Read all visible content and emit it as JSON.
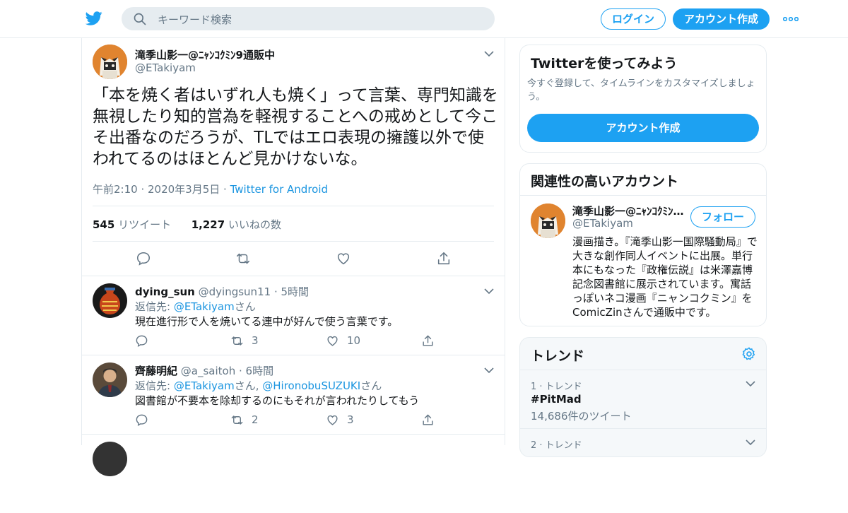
{
  "header": {
    "search_placeholder": "キーワード検索",
    "login_label": "ログイン",
    "signup_label": "アカウント作成"
  },
  "tweet": {
    "author_name": "滝季山影一@ﾆｬﾝｺｸﾐﾝ9通販中",
    "author_handle": "@ETakiyam",
    "text": "「本を焼く者はいずれ人も焼く」って言葉、専門知識を無視したり知的営為を軽視することへの戒めとして今こそ出番なのだろうが、TLではエロ表現の擁護以外で使われてるのはほとんど見かけないな。",
    "timestamp": "午前2:10 · 2020年3月5日",
    "separator": "·",
    "source": "Twitter for Android",
    "retweet_count": "545",
    "retweet_label": "リツイート",
    "like_count": "1,227",
    "like_label": "いいねの数"
  },
  "replies": [
    {
      "name": "dying_sun",
      "handle": "@dyingsun11",
      "time": "· 5時間",
      "reply_prefix": "返信先: ",
      "reply_to": "@ETakiyam",
      "reply_suffix": "さん",
      "reply_to2": "",
      "reply_suffix2": "",
      "text": "現在進行形で人を焼いてる連中が好んで使う言葉です。",
      "retweets": "3",
      "likes": "10"
    },
    {
      "name": "齊藤明紀",
      "handle": "@a_saitoh",
      "time": "· 6時間",
      "reply_prefix": "返信先: ",
      "reply_to": "@ETakiyam",
      "reply_suffix": "さん, ",
      "reply_to2": "@HironobuSUZUKI",
      "reply_suffix2": "さん",
      "text": "図書館が不要本を除却するのにもそれが言われたりしてもう",
      "retweets": "2",
      "likes": "3"
    }
  ],
  "sidebar": {
    "try_title": "Twitterを使ってみよう",
    "try_sub": "今すぐ登録して、タイムラインをカスタマイズしましょう。",
    "try_button": "アカウント作成",
    "related_title": "関連性の高いアカウント",
    "related_name": "滝季山影一@ﾆｬﾝｺｸﾐﾝ9通販中",
    "related_handle": "@ETakiyam",
    "follow_label": "フォロー",
    "related_bio": "漫画描き。『滝季山影一国際騒動局』で大きな創作同人イベントに出展。単行本にもなった『政権伝説』は米澤嘉博記念図書館に展示されています。寓話っぽいネコ漫画『ニャンコクミン』をComicZinさんで通販中です。",
    "trends_title": "トレンド",
    "trends": [
      {
        "rank": "1 · トレンド",
        "name": "#PitMad",
        "count": "14,686件のツイート"
      },
      {
        "rank": "2 · トレンド",
        "name": "",
        "count": ""
      }
    ]
  },
  "colors": {
    "accent": "#1da1f2",
    "link": "#1b95e0",
    "muted": "#657786",
    "text": "#14171a"
  }
}
